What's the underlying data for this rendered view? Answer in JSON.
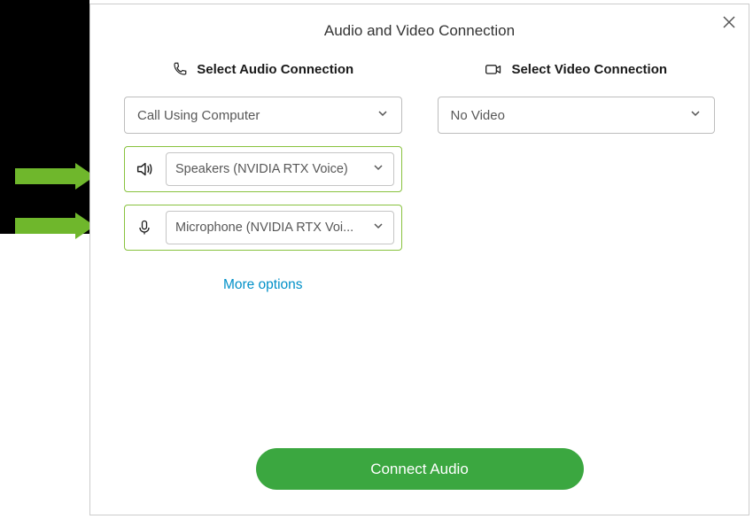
{
  "dialog": {
    "title": "Audio and Video Connection"
  },
  "audio": {
    "heading": "Select Audio Connection",
    "connection_select": "Call Using Computer",
    "speaker_select": "Speakers (NVIDIA RTX Voice)",
    "mic_select": "Microphone (NVIDIA RTX Voi...",
    "more_options": "More options"
  },
  "video": {
    "heading": "Select Video Connection",
    "connection_select": "No Video"
  },
  "footer": {
    "connect_button": "Connect Audio"
  }
}
